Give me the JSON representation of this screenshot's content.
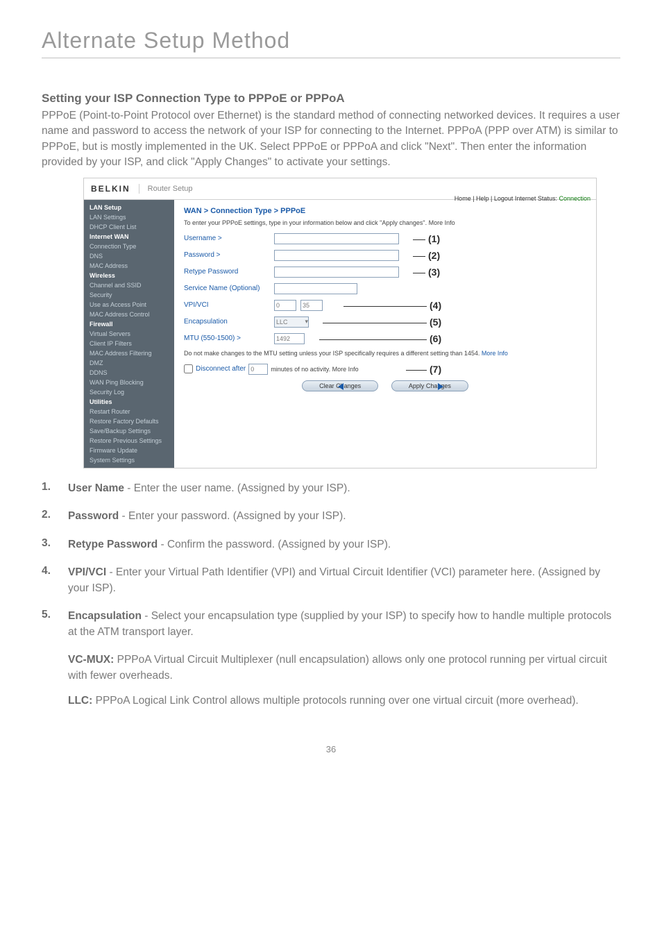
{
  "page_title": "Alternate Setup Method",
  "section_heading": "Setting your ISP Connection Type to PPPoE or PPPoA",
  "intro": "PPPoE (Point-to-Point Protocol over Ethernet) is the standard method of connecting networked devices. It requires a user name and password to access the network of your ISP for connecting to the Internet. PPPoA (PPP over ATM) is similar to PPPoE, but is mostly implemented in the UK. Select PPPoE or PPPoA and click \"Next\". Then enter the information provided by your ISP, and click \"Apply Changes\" to activate your settings.",
  "router": {
    "logo": "BELKIN",
    "title": "Router Setup",
    "status_prefix": "Home | Help | Logout   Internet Status: ",
    "status_value": "Connection",
    "sidebar": {
      "groups": [
        {
          "cat": "LAN Setup",
          "items": [
            "LAN Settings",
            "DHCP Client List"
          ]
        },
        {
          "cat": "Internet WAN",
          "items": [
            "Connection Type",
            "DNS",
            "MAC Address"
          ]
        },
        {
          "cat": "Wireless",
          "items": [
            "Channel and SSID",
            "Security",
            "Use as Access Point",
            "MAC Address Control"
          ]
        },
        {
          "cat": "Firewall",
          "items": [
            "Virtual Servers",
            "Client IP Filters",
            "MAC Address Filtering",
            "DMZ",
            "DDNS",
            "WAN Ping Blocking",
            "Security Log"
          ]
        },
        {
          "cat": "Utilities",
          "items": [
            "Restart Router",
            "Restore Factory Defaults",
            "Save/Backup Settings",
            "Restore Previous Settings",
            "Firmware Update",
            "System Settings"
          ]
        }
      ]
    },
    "breadcrumb": "WAN > Connection Type > PPPoE",
    "note": "To enter your PPPoE settings, type in your information below and click \"Apply changes\". More Info",
    "fields": {
      "username": "Username >",
      "password": "Password >",
      "retype": "Retype Password",
      "service": "Service Name (Optional)",
      "vpivci": "VPI/VCI",
      "vpi_val": "0",
      "vci_val": "35",
      "encap": "Encapsulation",
      "encap_val": "LLC",
      "mtu": "MTU (550-1500) >",
      "mtu_val": "1492",
      "mtu_note_1": "Do not make changes to the MTU setting unless your ISP specifically requires a different setting than 1454. ",
      "mtu_note_link": "More Info",
      "disconnect": "Disconnect after",
      "disconnect_val": "0",
      "disconnect_suffix": "minutes of no activity. More Info"
    },
    "buttons": {
      "clear": "Clear Changes",
      "apply": "Apply Changes"
    },
    "callouts": {
      "c1": "(1)",
      "c2": "(2)",
      "c3": "(3)",
      "c4": "(4)",
      "c5": "(5)",
      "c6": "(6)",
      "c7": "(7)"
    }
  },
  "list": [
    {
      "num": "1.",
      "term": "User Name",
      "text": " - Enter the user name. (Assigned by your ISP)."
    },
    {
      "num": "2.",
      "term": "Password",
      "text": " - Enter your password. (Assigned by your ISP)."
    },
    {
      "num": "3.",
      "term": "Retype Password",
      "text": " - Confirm the password. (Assigned by your ISP)."
    },
    {
      "num": "4.",
      "term": "VPI/VCI",
      "text": " - Enter your Virtual Path Identifier (VPI) and Virtual Circuit Identifier (VCI) parameter here. (Assigned by your ISP)."
    },
    {
      "num": "5.",
      "term": "Encapsulation",
      "text": " - Select your encapsulation type (supplied by your ISP) to specify how to handle multiple protocols at the ATM transport layer."
    }
  ],
  "sub": [
    {
      "term": "VC-MUX:",
      "text": " PPPoA Virtual Circuit Multiplexer (null encapsulation) allows only one protocol running per virtual circuit with fewer overheads."
    },
    {
      "term": "LLC:",
      "text": " PPPoA Logical Link Control allows multiple protocols running over one virtual circuit (more overhead)."
    }
  ],
  "page_number": "36"
}
